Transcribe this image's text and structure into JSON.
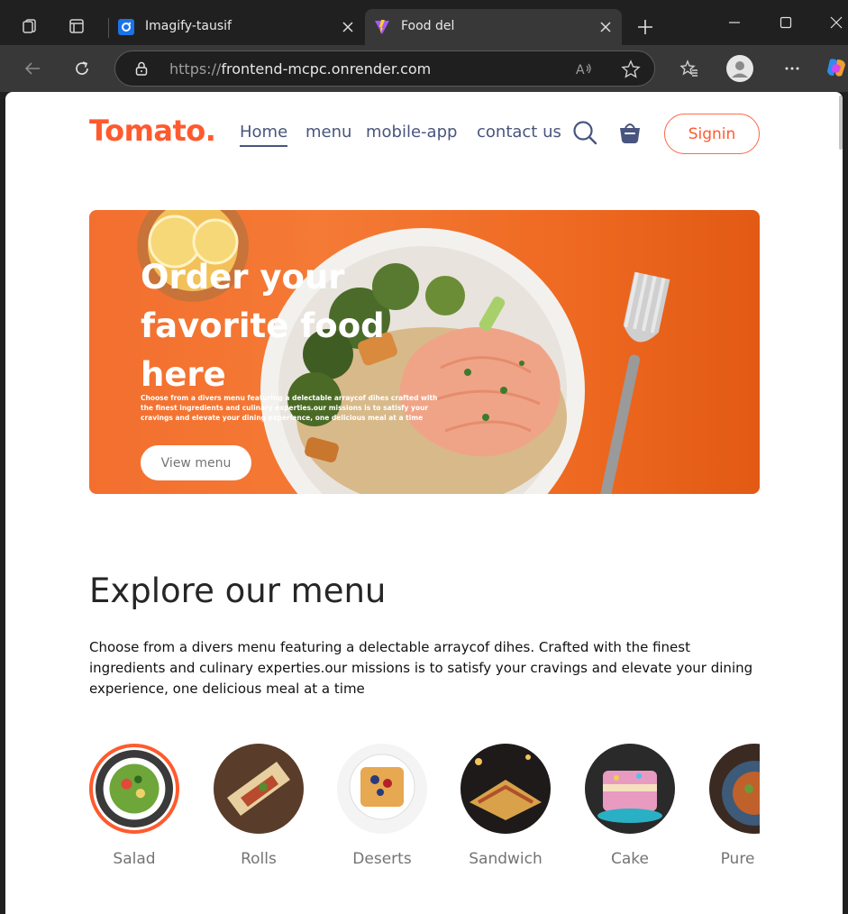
{
  "browser": {
    "tabs": [
      {
        "title": "Imagify-tausif",
        "active": false
      },
      {
        "title": "Food del",
        "active": true
      }
    ],
    "url_scheme": "https://",
    "url_host": "frontend-mcpc.onrender.com"
  },
  "site": {
    "logo": "Tomato.",
    "nav": [
      "Home",
      "menu",
      "mobile-app",
      "contact us"
    ],
    "signin_label": "Signin"
  },
  "hero": {
    "title": "Order your favorite food here",
    "description": "Choose from a divers menu featuring a delectable arraycof dihes crafted with the finest ingredients and culinary experties.our missions is to satisfy your cravings and elevate your dining experience, one delicious meal at a time",
    "button_label": "View menu"
  },
  "explore": {
    "title": "Explore our menu",
    "text": "Choose from a divers menu featuring a delectable arraycof dihes. Crafted with the finest ingredients and culinary experties.our missions is to satisfy your cravings and elevate your dining experience, one delicious meal at a time",
    "items": [
      "Salad",
      "Rolls",
      "Deserts",
      "Sandwich",
      "Cake",
      "Pure Veg"
    ],
    "active_item": "Salad"
  },
  "colors": {
    "brand": "#ff5a2e",
    "nav_text": "#49557e",
    "hero_bg": "#f36f2f"
  }
}
